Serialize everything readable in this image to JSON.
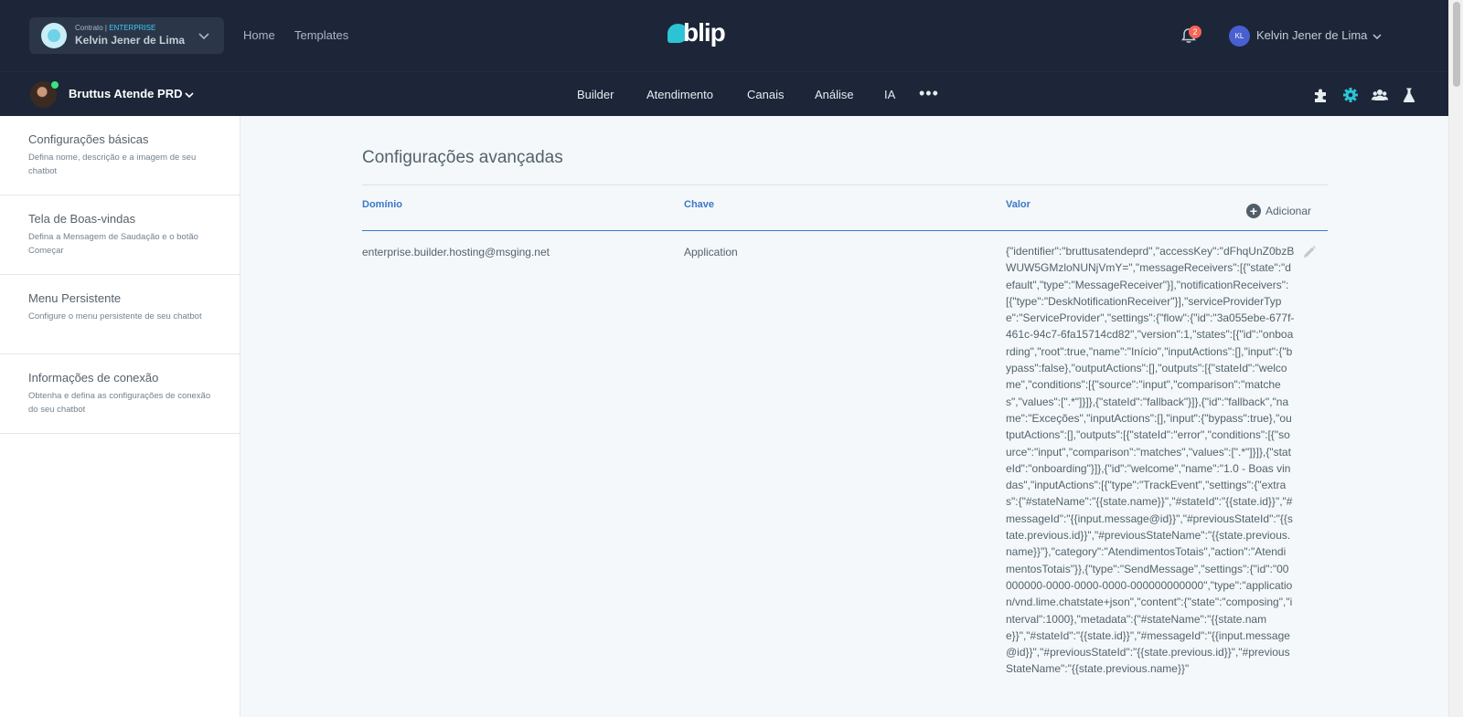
{
  "contract": {
    "prefix": "Contrato |",
    "plan": "ENTERPRISE",
    "name": "Kelvin Jener de Lima"
  },
  "top_nav": {
    "home": "Home",
    "templates": "Templates"
  },
  "logo_text": "blip",
  "notifications": {
    "count": "2"
  },
  "user": {
    "initials": "KL",
    "name": "Kelvin Jener de Lima"
  },
  "bot": {
    "name": "Bruttus Atende PRD"
  },
  "main_nav": {
    "builder": "Builder",
    "atendimento": "Atendimento",
    "canais": "Canais",
    "analise": "Análise",
    "ia": "IA",
    "more": "•••"
  },
  "toolbar_icons": [
    "puzzle-icon",
    "gear-icon",
    "team-icon",
    "flask-icon"
  ],
  "colors": {
    "accent": "#3a78c9",
    "header_bg": "#1c2638",
    "active_icon": "#2cc3d5"
  },
  "sidebar": {
    "items": [
      {
        "title": "Configurações básicas",
        "desc": "Defina nome, descrição e a imagem de seu chatbot"
      },
      {
        "title": "Tela de Boas-vindas",
        "desc": "Defina a Mensagem de Saudação e o botão Começar"
      },
      {
        "title": "Menu Persistente",
        "desc": "Configure o menu persistente de seu chatbot"
      },
      {
        "title": "Informações de conexão",
        "desc": "Obtenha e defina as configurações de conexão do seu chatbot"
      }
    ]
  },
  "main": {
    "title": "Configurações avançadas",
    "columns": {
      "domain": "Domínio",
      "key": "Chave",
      "value": "Valor"
    },
    "add_label": "Adicionar",
    "rows": [
      {
        "domain": "enterprise.builder.hosting@msging.net",
        "key": "Application",
        "value": "{\"identifier\":\"bruttusatendeprd\",\"accessKey\":\"dFhqUnZ0bzBWUW5GMzloNUNjVmY=\",\"messageReceivers\":[{\"state\":\"default\",\"type\":\"MessageReceiver\"}],\"notificationReceivers\":[{\"type\":\"DeskNotificationReceiver\"}],\"serviceProviderType\":\"ServiceProvider\",\"settings\":{\"flow\":{\"id\":\"3a055ebe-677f-461c-94c7-6fa15714cd82\",\"version\":1,\"states\":[{\"id\":\"onboarding\",\"root\":true,\"name\":\"Início\",\"inputActions\":[],\"input\":{\"bypass\":false},\"outputActions\":[],\"outputs\":[{\"stateId\":\"welcome\",\"conditions\":[{\"source\":\"input\",\"comparison\":\"matches\",\"values\":[\".*\"]}]},{\"stateId\":\"fallback\"}]},{\"id\":\"fallback\",\"name\":\"Exceções\",\"inputActions\":[],\"input\":{\"bypass\":true},\"outputActions\":[],\"outputs\":[{\"stateId\":\"error\",\"conditions\":[{\"source\":\"input\",\"comparison\":\"matches\",\"values\":[\".*\"]}]},{\"stateId\":\"onboarding\"}]},{\"id\":\"welcome\",\"name\":\"1.0 - Boas vindas\",\"inputActions\":[{\"type\":\"TrackEvent\",\"settings\":{\"extras\":{\"#stateName\":\"{{state.name}}\",\"#stateId\":\"{{state.id}}\",\"#messageId\":\"{{input.message@id}}\",\"#previousStateId\":\"{{state.previous.id}}\",\"#previousStateName\":\"{{state.previous.name}}\"},\"category\":\"AtendimentosTotais\",\"action\":\"AtendimentosTotais\"}},{\"type\":\"SendMessage\",\"settings\":{\"id\":\"00000000-0000-0000-0000-000000000000\",\"type\":\"application/vnd.lime.chatstate+json\",\"content\":{\"state\":\"composing\",\"interval\":1000},\"metadata\":{\"#stateName\":\"{{state.name}}\",\"#stateId\":\"{{state.id}}\",\"#messageId\":\"{{input.message@id}}\",\"#previousStateId\":\"{{state.previous.id}}\",\"#previousStateName\":\"{{state.previous.name}}\""
      }
    ]
  }
}
